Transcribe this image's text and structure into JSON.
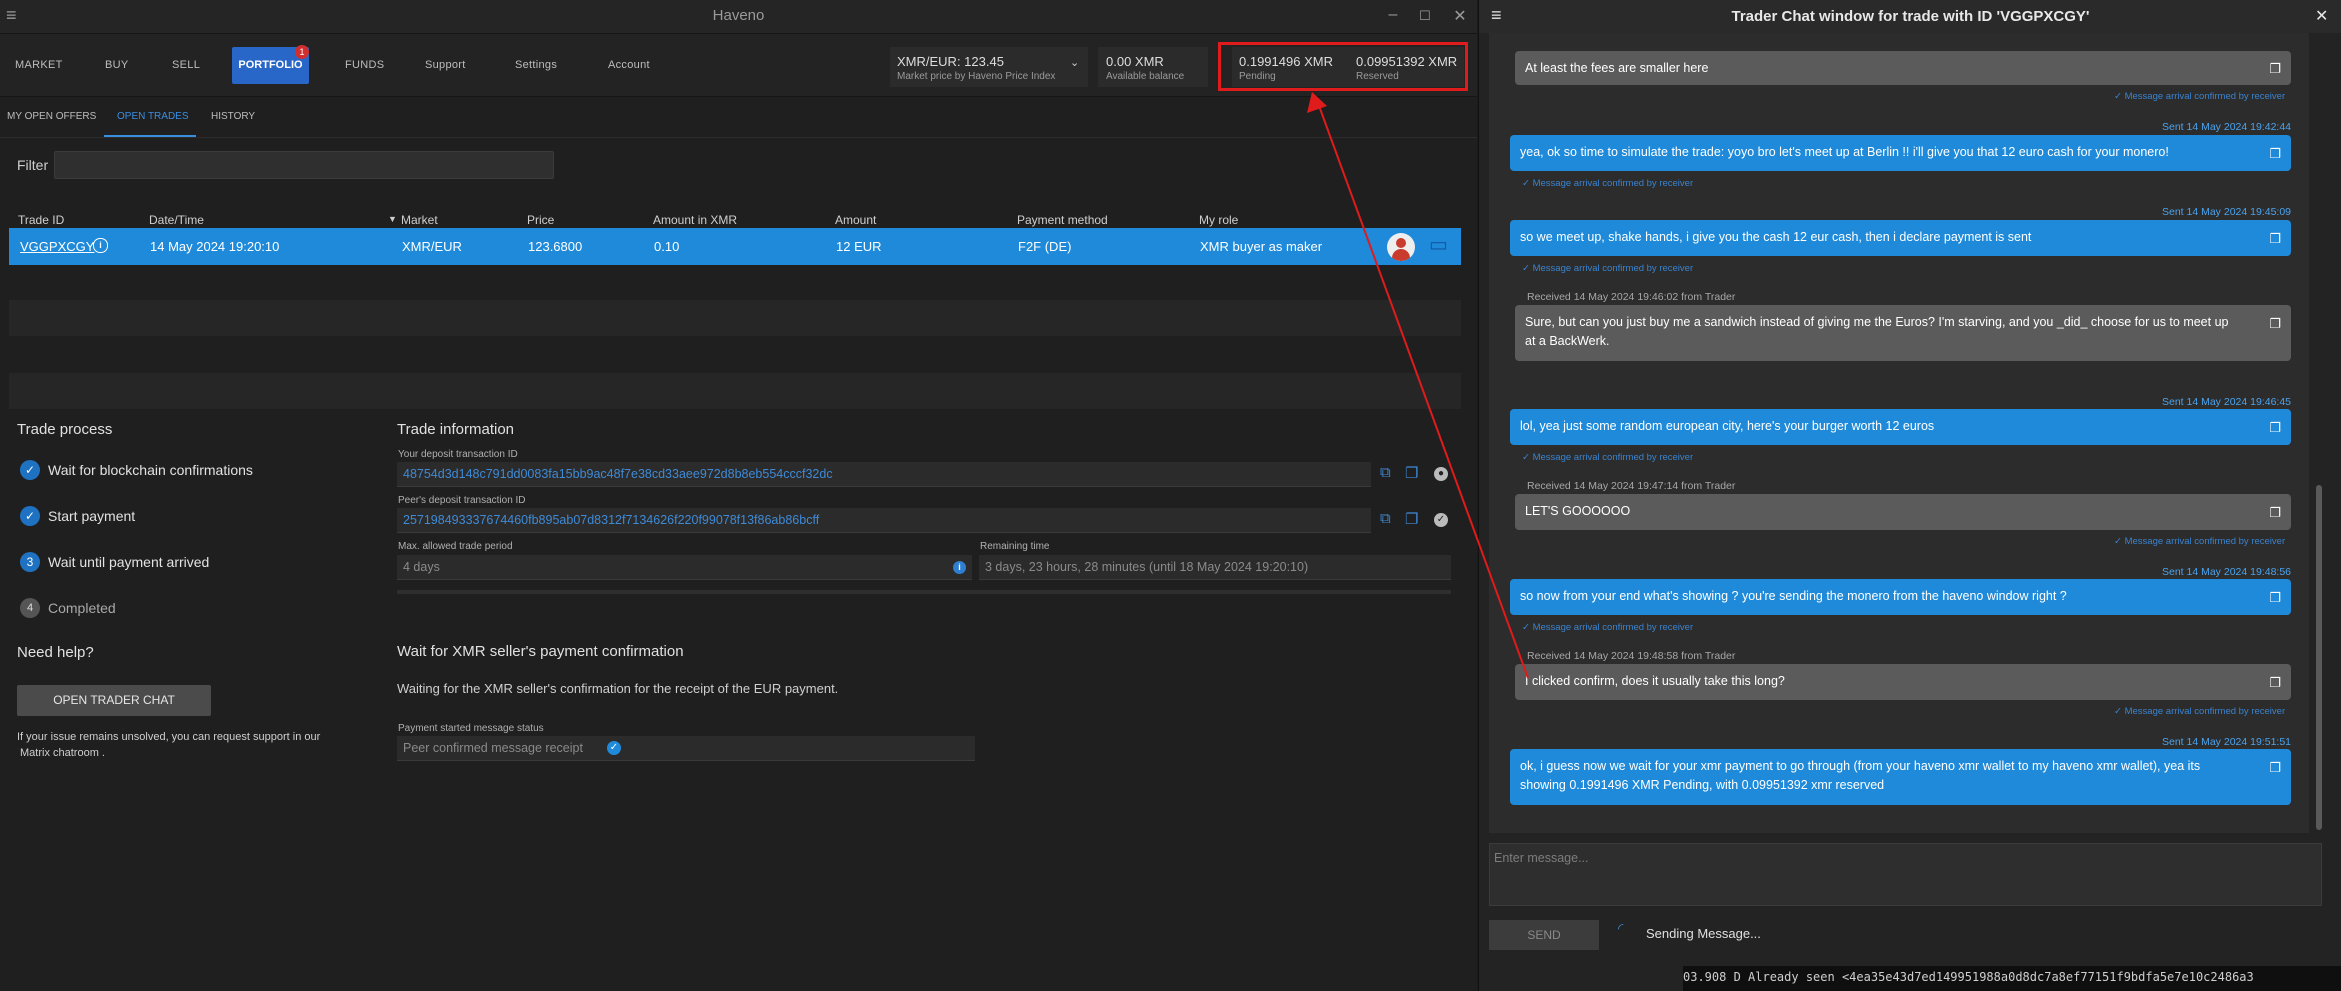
{
  "haveno": {
    "title": "Haveno",
    "nav": {
      "market": "MARKET",
      "buy": "BUY",
      "sell": "SELL",
      "portfolio": "PORTFOLIO",
      "portfolio_badge": "1",
      "funds": "FUNDS",
      "support": "Support",
      "settings": "Settings",
      "account": "Account"
    },
    "price": {
      "value": "XMR/EUR: 123.45",
      "label": "Market price by Haveno Price Index"
    },
    "balances": [
      {
        "value": "0.00 XMR",
        "label": "Available balance"
      },
      {
        "value": "0.1991496 XMR",
        "label": "Pending"
      },
      {
        "value": "0.09951392 XMR",
        "label": "Reserved"
      }
    ],
    "subtabs": [
      "MY OPEN OFFERS",
      "OPEN TRADES",
      "HISTORY"
    ],
    "filter_label": "Filter",
    "table": {
      "headers": [
        "Trade ID",
        "Date/Time",
        "Market",
        "Price",
        "Amount in XMR",
        "Amount",
        "Payment method",
        "My role"
      ],
      "row": [
        "VGGPXCGY",
        "14 May 2024 19:20:10",
        "XMR/EUR",
        "123.6800",
        "0.10",
        "12 EUR",
        "F2F (DE)",
        "XMR buyer as maker"
      ]
    },
    "process": {
      "title": "Trade process",
      "steps": [
        "Wait for blockchain confirmations",
        "Start payment",
        "Wait until payment arrived",
        "Completed"
      ],
      "step_numbers": [
        "3",
        "4"
      ]
    },
    "help": {
      "title": "Need help?",
      "button": "OPEN TRADER CHAT",
      "text1": "If your issue remains unsolved, you can request support in our",
      "text2": "Matrix chatroom ."
    },
    "info": {
      "title": "Trade information",
      "deposit_label": "Your deposit transaction ID",
      "deposit_value": "48754d3d148c791dd0083fa15bb9ac48f7e38cd33aee972d8b8eb554cccf32dc",
      "peer_label": "Peer's deposit transaction ID",
      "peer_value": "257198493337674460fb895ab07d8312f7134626f220f99078f13f86ab86bcff",
      "period_label": "Max. allowed trade period",
      "period_value": "4 days",
      "remaining_label": "Remaining time",
      "remaining_value": "3 days, 23 hours, 28 minutes (until 18 May 2024 19:20:10)"
    },
    "wait": {
      "title": "Wait for XMR seller's payment confirmation",
      "text": "Waiting for the XMR seller's confirmation for the receipt of the EUR payment.",
      "status_label": "Payment started message status",
      "status_value": "Peer confirmed message receipt"
    }
  },
  "chat": {
    "title": "Trader Chat window for trade with ID 'VGGPXCGY'",
    "ack": "Message arrival confirmed by receiver",
    "messages": [
      {
        "text": "At least the fees are smaller here"
      },
      {
        "time": "Sent 14 May 2024 19:42:44",
        "text": "yea, ok so time to simulate the trade: yoyo bro let's meet up at Berlin !! i'll give you that 12 euro cash for your monero!"
      },
      {
        "time": "Sent 14 May 2024 19:45:09",
        "text": "so we meet up, shake hands, i give you the cash 12 eur cash, then i declare payment is sent"
      },
      {
        "time": "Received 14 May 2024 19:46:02 from Trader",
        "text1": "Sure, but can you just buy me a sandwich instead of giving me the Euros? I'm starving, and you _did_ choose for us to meet up",
        "text2": "at a BackWerk."
      },
      {
        "time": "Sent 14 May 2024 19:46:45",
        "text": "lol, yea just some random european city, here's your burger worth 12 euros"
      },
      {
        "time": "Received 14 May 2024 19:47:14 from Trader",
        "text": "LET'S GOOOOOO"
      },
      {
        "time": "Sent 14 May 2024 19:48:56",
        "text": "so now from your end what's showing ? you're sending the monero from the haveno window right ?"
      },
      {
        "time": "Received 14 May 2024 19:48:58 from Trader",
        "text": "I clicked confirm, does it usually take this long?"
      },
      {
        "time": "Sent 14 May 2024 19:51:51",
        "text1": "ok, i guess now we wait for your xmr payment to go through (from your haveno xmr wallet to my haveno xmr wallet), yea its",
        "text2": "showing 0.1991496 XMR Pending, with 0.09951392 xmr reserved"
      }
    ],
    "input_placeholder": "Enter message...",
    "send_label": "SEND",
    "sending_status": "Sending Message...",
    "terminal_line": "03.908 D Already seen <4ea35e43d7ed149951988a0d8dc7a8ef77151f9bdfa5e7e10c2486a3"
  },
  "colors": {
    "accent": "#1f8ad9",
    "highlight": "#e01b1b",
    "theirs_bubble": "#5b5b5b"
  }
}
